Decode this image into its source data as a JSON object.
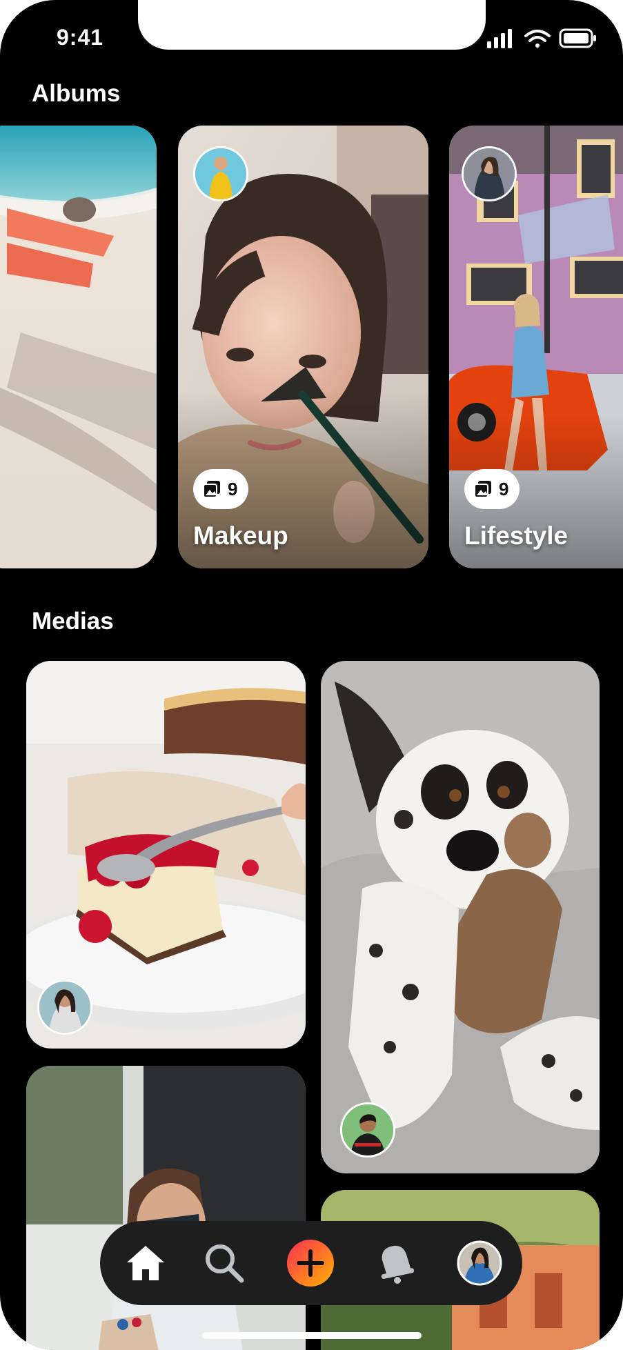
{
  "status_bar": {
    "time": "9:41"
  },
  "sections": {
    "albums_title": "Albums",
    "medias_title": "Medias"
  },
  "albums": [
    {
      "title": "",
      "count": ""
    },
    {
      "title": "Makeup",
      "count": "9"
    },
    {
      "title": "Lifestyle",
      "count": "9"
    }
  ],
  "nav": {
    "items": [
      "home-icon",
      "search-icon",
      "add-icon",
      "bell-icon",
      "profile-avatar"
    ],
    "active": "home",
    "accent_gradient": [
      "#ff2d55",
      "#ffb300"
    ]
  },
  "colors": {
    "background": "#000000",
    "text": "#ffffff",
    "nav_bar": "#1e1e1e"
  }
}
